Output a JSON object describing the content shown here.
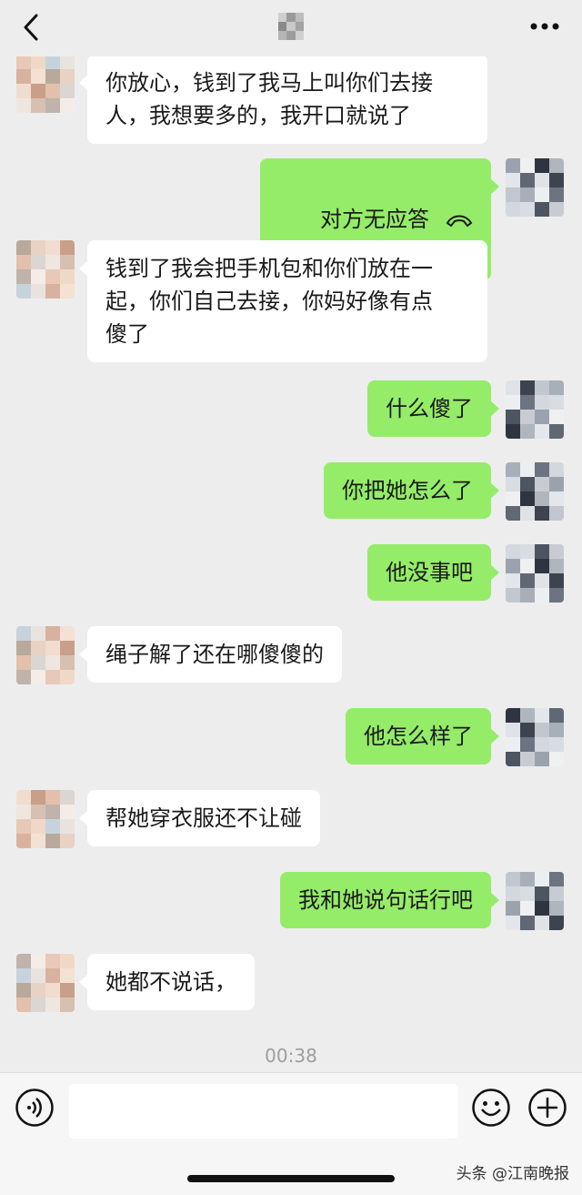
{
  "messages": [
    {
      "side": "left",
      "text": "你放心，钱到了我马上叫你们去接\n人，我想要多的，我开口就说了"
    },
    {
      "side": "right",
      "text": "对方无应答",
      "icon": "hang-up-icon"
    },
    {
      "side": "left",
      "text": "钱到了我会把手机包和你们放在一\n起，你们自己去接，你妈好像有点\n傻了"
    },
    {
      "side": "right",
      "text": "什么傻了"
    },
    {
      "side": "right",
      "text": "你把她怎么了"
    },
    {
      "side": "right",
      "text": "他没事吧"
    },
    {
      "side": "left",
      "text": "绳子解了还在哪傻傻的"
    },
    {
      "side": "right",
      "text": "他怎么样了"
    },
    {
      "side": "left",
      "text": "帮她穿衣服还不让碰"
    },
    {
      "side": "right",
      "text": "我和她说句话行吧"
    },
    {
      "side": "left",
      "text": "她都不说话，"
    }
  ],
  "timestamp": "00:38",
  "input": {
    "value": "",
    "placeholder": ""
  },
  "watermark": "头条 @江南晚报",
  "colors": {
    "sent_bubble": "#95ec69",
    "received_bubble": "#ffffff",
    "background": "#ededed"
  },
  "icons": {
    "back": "chevron-left-icon",
    "more": "more-dots-icon",
    "voice": "voice-icon",
    "emoji": "emoji-icon",
    "plus": "plus-icon"
  }
}
